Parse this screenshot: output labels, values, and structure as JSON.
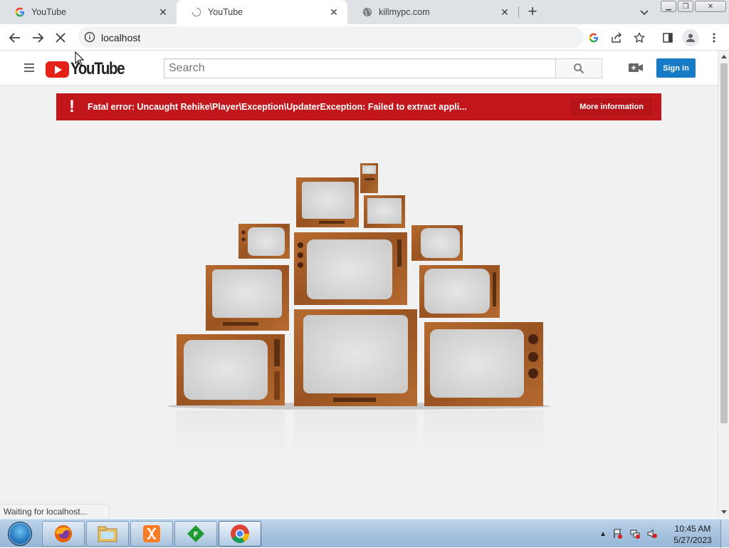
{
  "browser": {
    "tabs": [
      {
        "title": "YouTube",
        "favicon": "google-g-icon",
        "active": false
      },
      {
        "title": "YouTube",
        "favicon": "loading-spinner-icon",
        "active": true
      },
      {
        "title": "killmypc.com",
        "favicon": "globe-icon",
        "active": false
      }
    ],
    "address": "localhost",
    "status_text": "Waiting for localhost..."
  },
  "youtube": {
    "logo_text": "YouTube",
    "search_placeholder": "Search",
    "signin_label": "Sign in",
    "error_message": "Fatal error: Uncaught Rehike\\Player\\Exception\\UpdaterException: Failed to extract appli...",
    "error_icon": "!",
    "more_info_label": "More information"
  },
  "taskbar": {
    "time": "10:45 AM",
    "date": "5/27/2023",
    "apps": [
      "firefox-icon",
      "file-explorer-icon",
      "xampp-icon",
      "filezilla-icon",
      "chrome-icon"
    ]
  },
  "colors": {
    "error_red": "#c1171c",
    "signin_blue": "#167ac6",
    "youtube_red": "#e62117"
  }
}
